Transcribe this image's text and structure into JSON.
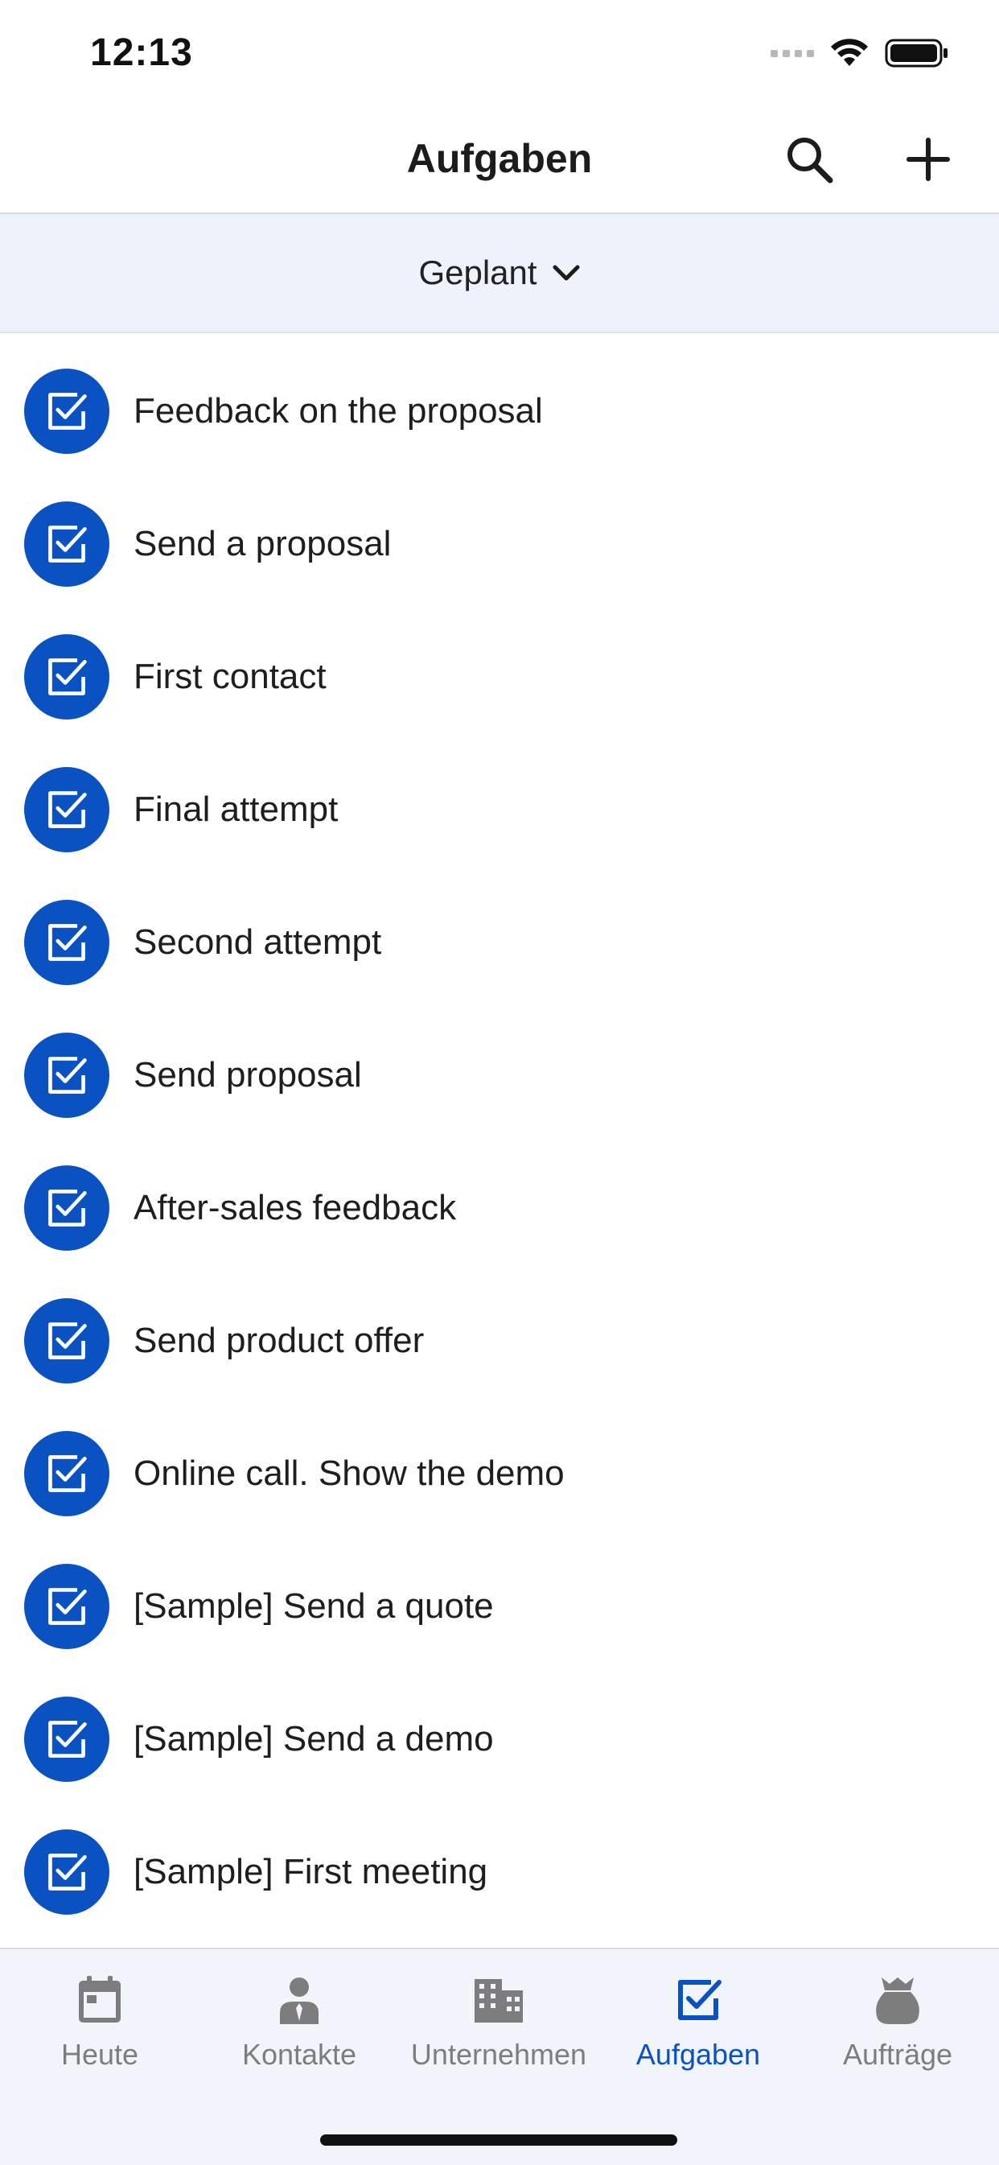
{
  "status_bar": {
    "time": "12:13"
  },
  "nav": {
    "title": "Aufgaben",
    "search_icon": "search-icon",
    "add_icon": "plus-icon"
  },
  "filter": {
    "label": "Geplant",
    "icon": "chevron-down-icon"
  },
  "tasks": [
    {
      "title": "Feedback on the proposal"
    },
    {
      "title": "Send a proposal"
    },
    {
      "title": "First contact"
    },
    {
      "title": "Final attempt"
    },
    {
      "title": "Second attempt"
    },
    {
      "title": "Send proposal"
    },
    {
      "title": "After-sales feedback"
    },
    {
      "title": "Send product offer"
    },
    {
      "title": "Online call. Show the demo"
    },
    {
      "title": "[Sample] Send a quote"
    },
    {
      "title": "[Sample] Send a demo"
    },
    {
      "title": "[Sample] First meeting"
    }
  ],
  "tabs": [
    {
      "label": "Heute",
      "icon": "calendar-icon"
    },
    {
      "label": "Kontakte",
      "icon": "person-icon"
    },
    {
      "label": "Unternehmen",
      "icon": "building-icon"
    },
    {
      "label": "Aufgaben",
      "icon": "checkbox-icon",
      "active": true
    },
    {
      "label": "Aufträge",
      "icon": "money-bag-icon"
    }
  ],
  "colors": {
    "accent": "#0a52c2",
    "inactive": "#7d7d7d",
    "filter_bg": "#eef3fb",
    "tabbar_bg": "#f1f4fa"
  }
}
